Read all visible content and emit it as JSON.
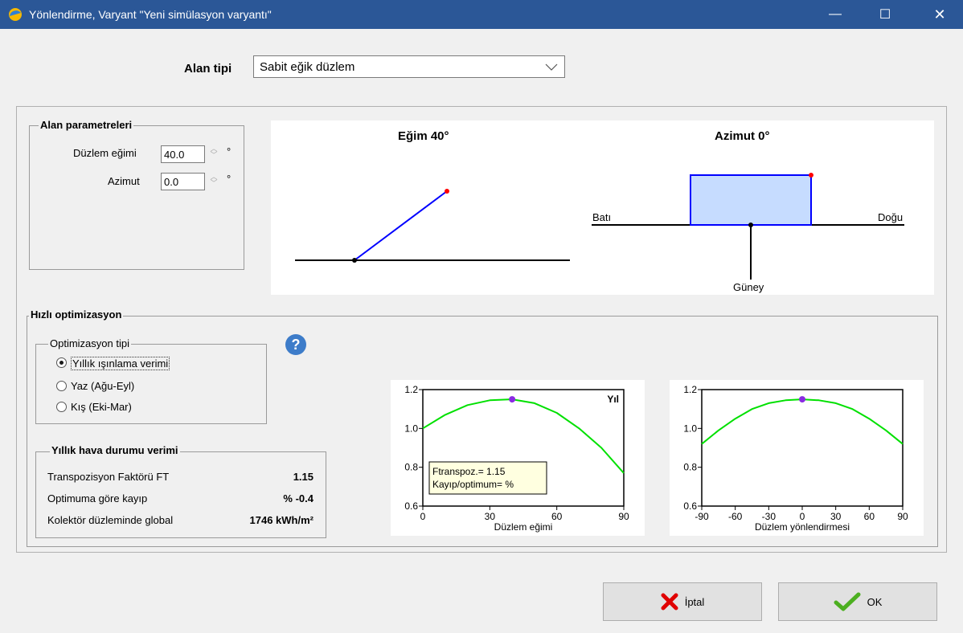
{
  "window": {
    "title": "Yönlendirme, Varyant \"Yeni simülasyon varyantı\"",
    "minimize_symbol": "—",
    "maximize_symbol": "☐",
    "close_symbol": "✕"
  },
  "field_type": {
    "label": "Alan tipi",
    "value": "Sabit eğik düzlem"
  },
  "field_params": {
    "title": "Alan parametreleri",
    "tilt_label": "Düzlem eğimi",
    "tilt_value": "40.0",
    "azimuth_label": "Azimut",
    "azimuth_value": "0.0",
    "unit": "°"
  },
  "diagram": {
    "tilt_title": "Eğim 40°",
    "azimuth_title": "Azimut 0°",
    "west": "Batı",
    "east": "Doğu",
    "south": "Güney"
  },
  "quick_opt": {
    "title": "Hızlı optimizasyon",
    "opt_type_title": "Optimizasyon tipi",
    "options": [
      "Yıllık ışınlama verimi",
      "Yaz (Ağu-Eyl)",
      "Kış (Eki-Mar)"
    ],
    "selected_index": 0,
    "help_symbol": "?"
  },
  "annual": {
    "title": "Yıllık hava durumu verimi",
    "rows": [
      {
        "label": "Transpozisyon Faktörü FT",
        "value": "1.15"
      },
      {
        "label": "Optimuma göre kayıp",
        "value": "% -0.4"
      },
      {
        "label": "Kolektör düzleminde global",
        "value": "1746 kWh/m²"
      }
    ]
  },
  "buttons": {
    "cancel": "İptal",
    "ok": "OK"
  },
  "colors": {
    "titlebar": "#2b5797",
    "curve": "#00e000",
    "marker": "#8a2be2",
    "plane": "#0000ff",
    "plane_fill": "#c6dcff",
    "edge_dot": "#ff0000"
  },
  "chart_data": [
    {
      "type": "line",
      "title": "",
      "corner_label": "Yıl",
      "xlabel": "Düzlem eğimi",
      "ylabel": "",
      "xlim": [
        0,
        90
      ],
      "ylim": [
        0.6,
        1.2
      ],
      "xticks": [
        0,
        30,
        60,
        90
      ],
      "yticks": [
        0.6,
        0.8,
        1.0,
        1.2
      ],
      "x": [
        0,
        10,
        20,
        30,
        40,
        50,
        60,
        70,
        80,
        90
      ],
      "series": [
        {
          "values": [
            1.0,
            1.07,
            1.12,
            1.145,
            1.15,
            1.13,
            1.08,
            1.0,
            0.9,
            0.77
          ]
        }
      ],
      "marker": {
        "x": 40,
        "y": 1.15
      },
      "info_lines": [
        "Ftranspoz.= 1.15",
        "Kayıp/optimum= %"
      ]
    },
    {
      "type": "line",
      "title": "",
      "xlabel": "Düzlem yönlendirmesi",
      "ylabel": "",
      "xlim": [
        -90,
        90
      ],
      "ylim": [
        0.6,
        1.2
      ],
      "xticks": [
        -90,
        -60,
        -30,
        0,
        30,
        60,
        90
      ],
      "yticks": [
        0.6,
        0.8,
        1.0,
        1.2
      ],
      "x": [
        -90,
        -75,
        -60,
        -45,
        -30,
        -15,
        0,
        15,
        30,
        45,
        60,
        75,
        90
      ],
      "series": [
        {
          "values": [
            0.92,
            0.99,
            1.05,
            1.1,
            1.13,
            1.145,
            1.15,
            1.145,
            1.13,
            1.1,
            1.05,
            0.99,
            0.92
          ]
        }
      ],
      "marker": {
        "x": 0,
        "y": 1.15
      }
    }
  ]
}
